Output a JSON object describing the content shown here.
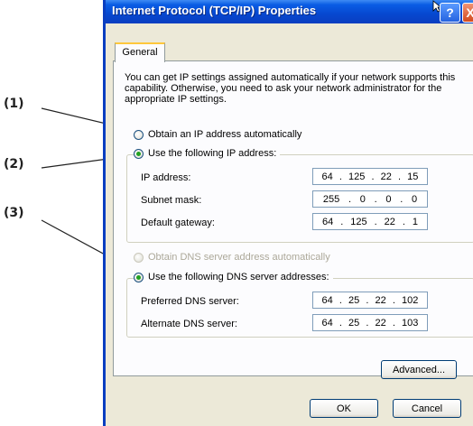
{
  "callouts": [
    "(1)",
    "(2)",
    "(3)"
  ],
  "dialog": {
    "title": "Internet Protocol (TCP/IP) Properties",
    "help_button": "?",
    "close_button": "X",
    "tab_general": "General",
    "intro_text": "You can get IP settings assigned automatically if your network supports this capability. Otherwise, you need to ask your network administrator for the appropriate IP settings.",
    "ip": {
      "auto_label": "Obtain an IP address automatically",
      "auto_selected": false,
      "manual_label": "Use the following IP address:",
      "manual_selected": true,
      "fields": [
        {
          "label": "IP address:",
          "octets": [
            "64",
            "125",
            "22",
            "15"
          ]
        },
        {
          "label": "Subnet mask:",
          "octets": [
            "255",
            "0",
            "0",
            "0"
          ]
        },
        {
          "label": "Default gateway:",
          "octets": [
            "64",
            "125",
            "22",
            "1"
          ]
        }
      ]
    },
    "dns": {
      "auto_label": "Obtain DNS server address automatically",
      "auto_enabled": false,
      "manual_label": "Use the following DNS server addresses:",
      "manual_selected": true,
      "fields": [
        {
          "label": "Preferred DNS server:",
          "octets": [
            "64",
            "25",
            "22",
            "102"
          ]
        },
        {
          "label": "Alternate DNS server:",
          "octets": [
            "64",
            "25",
            "22",
            "103"
          ]
        }
      ]
    },
    "advanced_button": "Advanced...",
    "ok_button": "OK",
    "cancel_button": "Cancel"
  }
}
